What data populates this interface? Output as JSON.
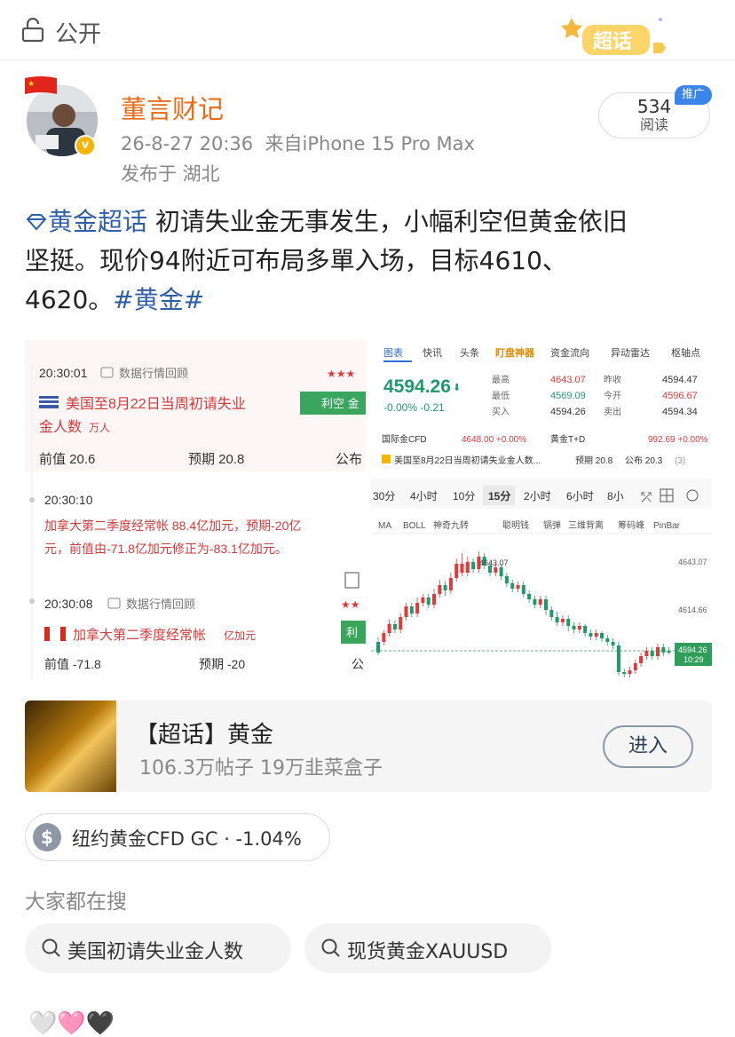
{
  "header": {
    "visibility_label": "公开",
    "badge_label": "超话"
  },
  "post": {
    "username": "董言财记",
    "timestamp": "26-8-27 20:36",
    "source": "来自iPhone 15 Pro Max",
    "location": "发布于 湖北",
    "read_count": "534",
    "read_label": "阅读",
    "promo_label": "推广",
    "topic_link": "黄金超话",
    "body_line1": "初请失业金无事发生，小幅利空但黄金依旧",
    "body_line2": "坚挺。现价94附近可布局多單入场，目标4610、",
    "body_line3": "4620。",
    "hashtag": "#黄金#"
  },
  "image_left": {
    "news1_time": "20:30:01",
    "news1_tag": "数据行情回顾",
    "news1_title": "美国至8月22日当周初请失业",
    "news1_title2": "金人数",
    "news1_unit": "万人",
    "news1_badge": "利空 金",
    "news1_prev": "前值 20.6",
    "news1_expect": "预期 20.8",
    "news1_pub": "公布",
    "news2_time": "20:30:10",
    "news2_line1": "加拿大第二季度经常帐 88.4亿加元，预期-20亿",
    "news2_line2": "元，前值由-71.8亿加元修正为-83.1亿加元。",
    "news3_time": "20:30:08",
    "news3_tag": "数据行情回顾",
    "news3_title": "加拿大第二季度经常帐",
    "news3_unit": "亿加元",
    "news3_badge": "利",
    "news3_prev": "前值 -71.8",
    "news3_expect": "预期 -20",
    "news3_pub": "公"
  },
  "image_right": {
    "tabs": [
      "图表",
      "快讯",
      "头条",
      "盯盘神器",
      "资金流向",
      "异动雷达",
      "枢轴点"
    ],
    "price": "4594.26",
    "change": "-0.00%  -0.21",
    "stats": [
      {
        "label": "最高",
        "value": "4643.07",
        "label2": "昨收",
        "value2": "4594.47"
      },
      {
        "label": "最低",
        "value": "4569.09",
        "label2": "今开",
        "value2": "4596.67"
      },
      {
        "label": "买入",
        "value": "4594.26",
        "label2": "卖出",
        "value2": "4594.34"
      }
    ],
    "cfd_label": "国际金CFD",
    "cfd_value": "4648.00 +0.00%",
    "td_label": "黄金T+D",
    "td_value": "992.69 +0.00%",
    "news_strip": "美国至8月22日当周初请失业金人数...",
    "news_strip_expect": "预期 20.8",
    "news_strip_pub": "公布 20.3",
    "news_strip_count": "(3)",
    "periods": [
      "30分",
      "4小时",
      "10分",
      "15分",
      "2小时",
      "6小时",
      "8小"
    ],
    "indicators": [
      "MA",
      "BOLL",
      "神奇九转",
      "聪明钱",
      "锅弹",
      "三维背离",
      "筹码峰",
      "PinBar"
    ],
    "high_label": "4643.07",
    "axis_top": "4643.07",
    "axis_mid": "4614.66",
    "current_label": "4594.26",
    "current_time": "10:29",
    "colors": {
      "up": "#e03a3a",
      "down": "#1f9a6b",
      "accent": "#2f6fd6"
    }
  },
  "topic_card": {
    "title": "【超话】黄金",
    "subtitle": "106.3万帖子 19万韭菜盒子",
    "enter_label": "进入"
  },
  "stock_chip": {
    "icon": "dollar-icon",
    "text": "纽约黄金CFD GC · -1.04%"
  },
  "search": {
    "heading": "大家都在搜",
    "items": [
      "美国初请失业金人数",
      "现货黄金XAUUSD"
    ]
  },
  "reactions": "🤍🩷🖤"
}
